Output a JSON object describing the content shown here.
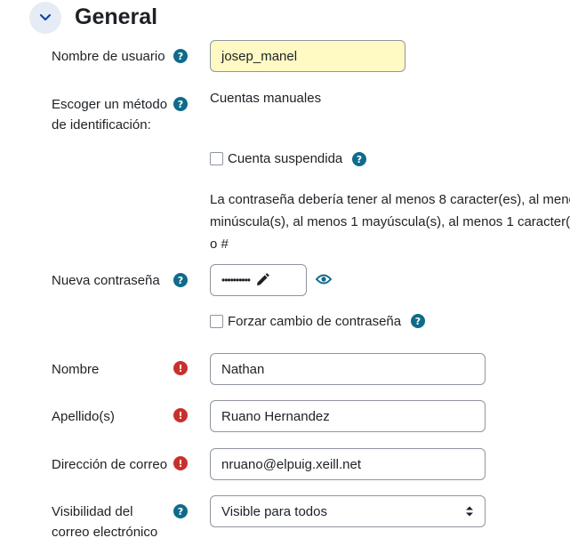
{
  "section": {
    "title": "General"
  },
  "fields": {
    "username": {
      "label": "Nombre de usuario",
      "value": "josep_manel"
    },
    "auth": {
      "label_line1": "Escoger un método",
      "label_line2": "de identificación:",
      "value": "Cuentas manuales"
    },
    "suspended": {
      "label": "Cuenta suspendida"
    },
    "password_note": {
      "line1": "La contraseña debería tener al menos 8 caracter(es), al meno",
      "line2": "minúscula(s), al menos 1 mayúscula(s), al menos 1 caracter(",
      "line3": "o #"
    },
    "new_password": {
      "label": "Nueva contraseña",
      "masked": "••••••••••"
    },
    "force_change": {
      "label": "Forzar cambio de contraseña"
    },
    "firstname": {
      "label": "Nombre",
      "value": "Nathan"
    },
    "lastname": {
      "label": "Apellido(s)",
      "value": "Ruano Hernandez"
    },
    "email": {
      "label": "Dirección de correo",
      "value": "nruano@elpuig.xeill.net"
    },
    "email_visibility": {
      "label_line1": "Visibilidad del",
      "label_line2": "correo electrónico",
      "value": "Visible para todos"
    }
  },
  "icons": {
    "help": "?",
    "required": "!"
  },
  "colors": {
    "help": "#0f6b8b",
    "required": "#c9302c",
    "highlight": "#fff9c4",
    "accent": "#0f6b8b"
  }
}
